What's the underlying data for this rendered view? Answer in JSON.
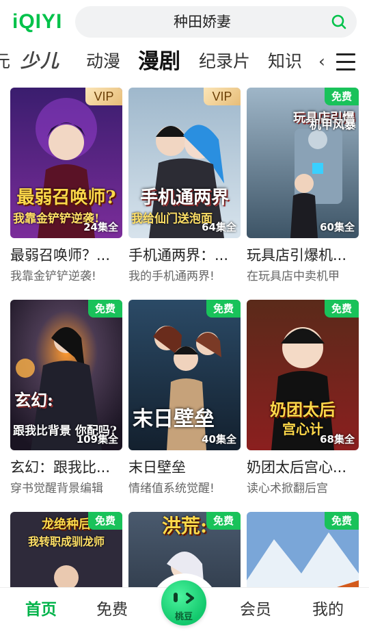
{
  "colors": {
    "brand": "#00c24a",
    "free_badge": "#19c25a",
    "vip_badge": "#e7bd78",
    "active_nav": "#00b34a"
  },
  "header": {
    "logo": "iQIYI",
    "search_text": "种田娇妻",
    "search_icon": "search-icon"
  },
  "tabs": {
    "items": [
      "元",
      "少儿",
      "动漫",
      "漫剧",
      "纪录片",
      "知识",
      "‹"
    ],
    "active": "漫剧",
    "menu_icon": "hamburger-menu-icon"
  },
  "cards": [
    {
      "title": "最弱召唤师？...",
      "subtitle": "我靠金铲铲逆袭!",
      "badge": "VIP",
      "episodes": "24集全",
      "poster_title": "最弱召唤师?",
      "poster_sub": "我靠金铲铲逆袭!"
    },
    {
      "title": "手机通两界：...",
      "subtitle": "我的手机通两界!",
      "badge": "VIP",
      "episodes": "64集全",
      "poster_title": "手机通两界",
      "poster_sub": "我给仙门送泡面"
    },
    {
      "title": "玩具店引爆机...",
      "subtitle": "在玩具店中卖机甲",
      "badge": "免费",
      "episodes": "60集全",
      "poster_title": "玩具店引爆",
      "poster_sub": "机甲风暴"
    },
    {
      "title": "玄幻：跟我比...",
      "subtitle": "穿书觉醒背景编辑",
      "badge": "免费",
      "episodes": "109集全",
      "poster_title": "玄幻:",
      "poster_sub": "跟我比背景 你配吗?"
    },
    {
      "title": "末日壁垒",
      "subtitle": "情绪值系统觉醒!",
      "badge": "免费",
      "episodes": "40集全",
      "poster_title": "末日壁垒",
      "poster_sub": ""
    },
    {
      "title": "奶团太后宫心...",
      "subtitle": "读心术掀翻后宫",
      "badge": "免费",
      "episodes": "68集全",
      "poster_title": "奶团太后",
      "poster_sub": "宫心计"
    },
    {
      "title": "",
      "subtitle": "",
      "badge": "免费",
      "episodes": "",
      "poster_title": "龙绝种后",
      "poster_sub": "我转职成驯龙师"
    },
    {
      "title": "",
      "subtitle": "",
      "badge": "免费",
      "episodes": "",
      "poster_title": "洪荒:",
      "poster_sub": ""
    },
    {
      "title": "",
      "subtitle": "",
      "badge": "免费",
      "episodes": "",
      "poster_title": "",
      "poster_sub": ""
    }
  ],
  "bottom_nav": {
    "items": [
      "首页",
      "免费",
      "桃豆",
      "会员",
      "我的"
    ],
    "active": "首页"
  }
}
